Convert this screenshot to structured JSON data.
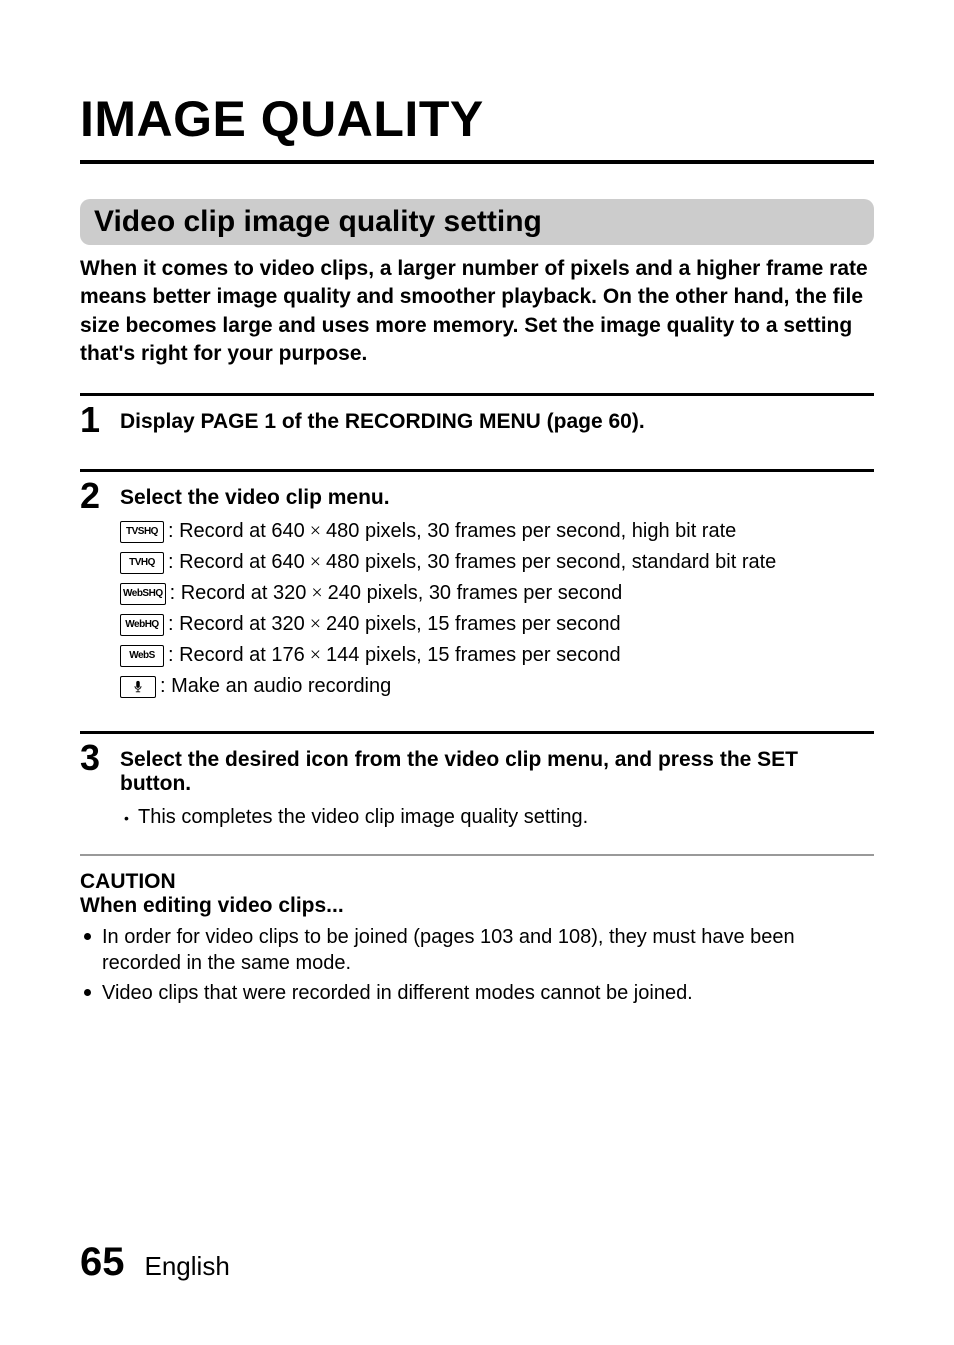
{
  "title": "IMAGE QUALITY",
  "section_header": "Video clip image quality setting",
  "lead": "When it comes to video clips, a larger number of pixels and a higher frame rate means better image quality and smoother playback. On the other hand, the file size becomes large and uses more memory. Set the image quality to a setting that's right for your purpose.",
  "steps": {
    "step1": {
      "num": "1",
      "heading": "Display PAGE 1 of the RECORDING MENU (page 60)."
    },
    "step2": {
      "num": "2",
      "heading": "Select the video clip menu.",
      "options": [
        {
          "icon": "TVSHQ",
          "text_pre": ": Record at 640",
          "text_mid": "480 pixels, 30 frames per second, high bit rate"
        },
        {
          "icon": "TVHQ",
          "text_pre": ": Record at 640",
          "text_mid": "480 pixels, 30 frames per second, standard bit rate"
        },
        {
          "icon": "WebSHQ",
          "text_pre": ": Record at 320",
          "text_mid": "240 pixels, 30 frames per second"
        },
        {
          "icon": "WebHQ",
          "text_pre": ": Record at 320",
          "text_mid": "240 pixels, 15 frames per second"
        },
        {
          "icon": "WebS",
          "text_pre": ": Record at 176",
          "text_mid": "144 pixels, 15 frames per second"
        },
        {
          "icon": "audio",
          "text_full": ": Make an audio recording"
        }
      ]
    },
    "step3": {
      "num": "3",
      "heading": "Select the desired icon from the video clip menu, and press the SET button.",
      "bullet": "This completes the video clip image quality setting."
    }
  },
  "caution": {
    "title": "CAUTION",
    "subtitle": "When editing video clips...",
    "bullets": [
      "In order for video clips to be joined (pages 103 and 108), they must have been recorded in the same mode.",
      "Video clips that were recorded in different modes cannot be joined."
    ]
  },
  "footer": {
    "page": "65",
    "lang": "English"
  }
}
